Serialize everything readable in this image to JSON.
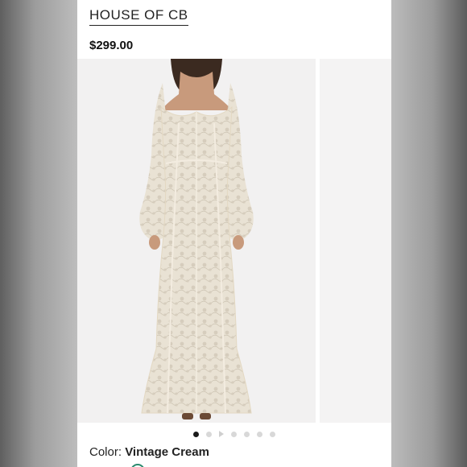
{
  "brand": {
    "name": "HOUSE OF CB"
  },
  "product": {
    "price": "$299.00",
    "color_label": "Color:",
    "color_value": "Vintage Cream"
  },
  "gallery": {
    "image_count": 7,
    "active_index": 0,
    "has_video": true
  },
  "colors": {
    "accent": "#2a8a6e",
    "dress": "#ece5d8",
    "background_image": "#f2f1f1"
  }
}
